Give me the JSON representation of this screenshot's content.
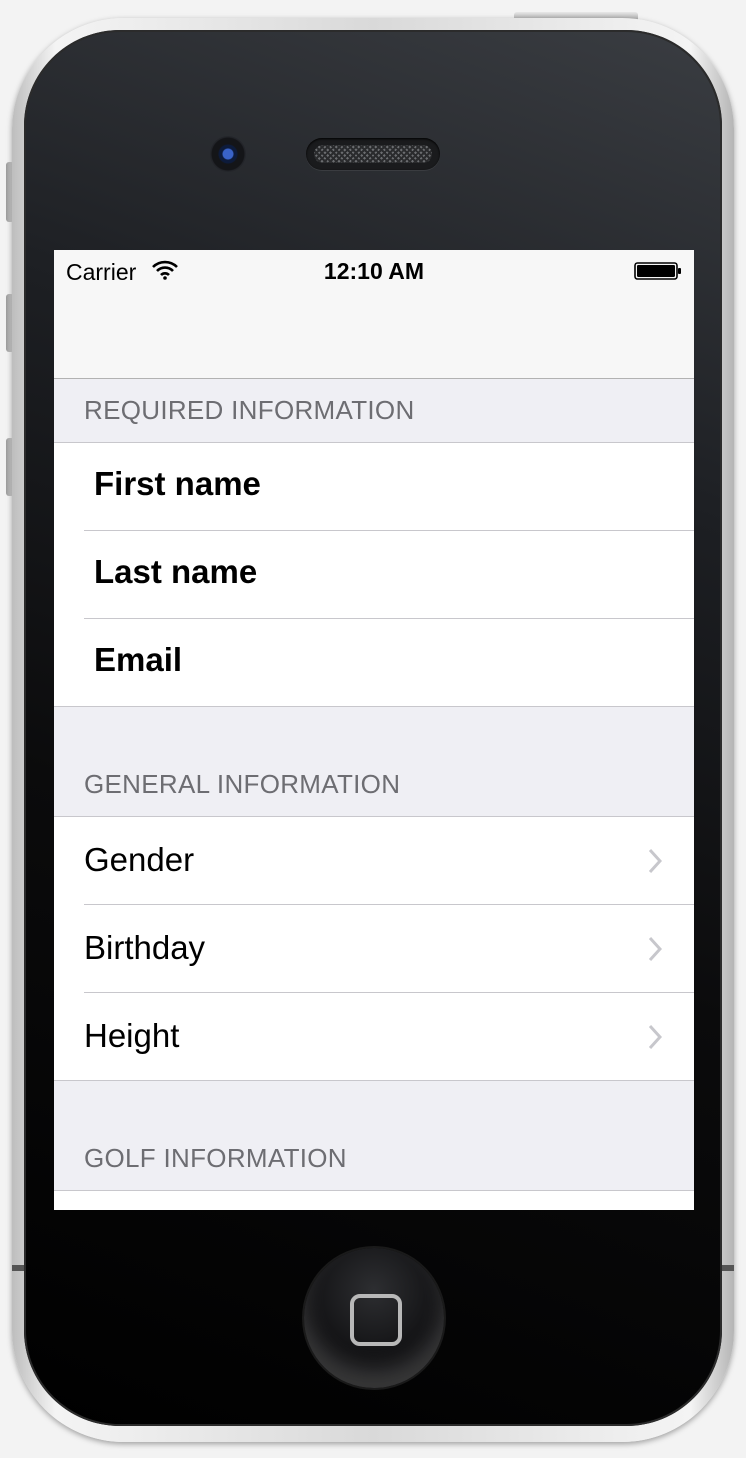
{
  "status_bar": {
    "carrier": "Carrier",
    "time": "12:10 AM"
  },
  "sections": {
    "required": {
      "header": "REQUIRED INFORMATION",
      "rows": [
        "First name",
        "Last name",
        "Email"
      ]
    },
    "general": {
      "header": "GENERAL INFORMATION",
      "rows": [
        "Gender",
        "Birthday",
        "Height"
      ]
    },
    "golf": {
      "header": "GOLF INFORMATION"
    }
  },
  "icons": {
    "wifi": "wifi-icon",
    "battery": "battery-icon",
    "chevron": "chevron-right-icon"
  },
  "colors": {
    "table_background": "#efeff4",
    "section_header_text": "#6d6d72",
    "separator": "#c8c7cc",
    "chevron": "#c7c7cc"
  }
}
